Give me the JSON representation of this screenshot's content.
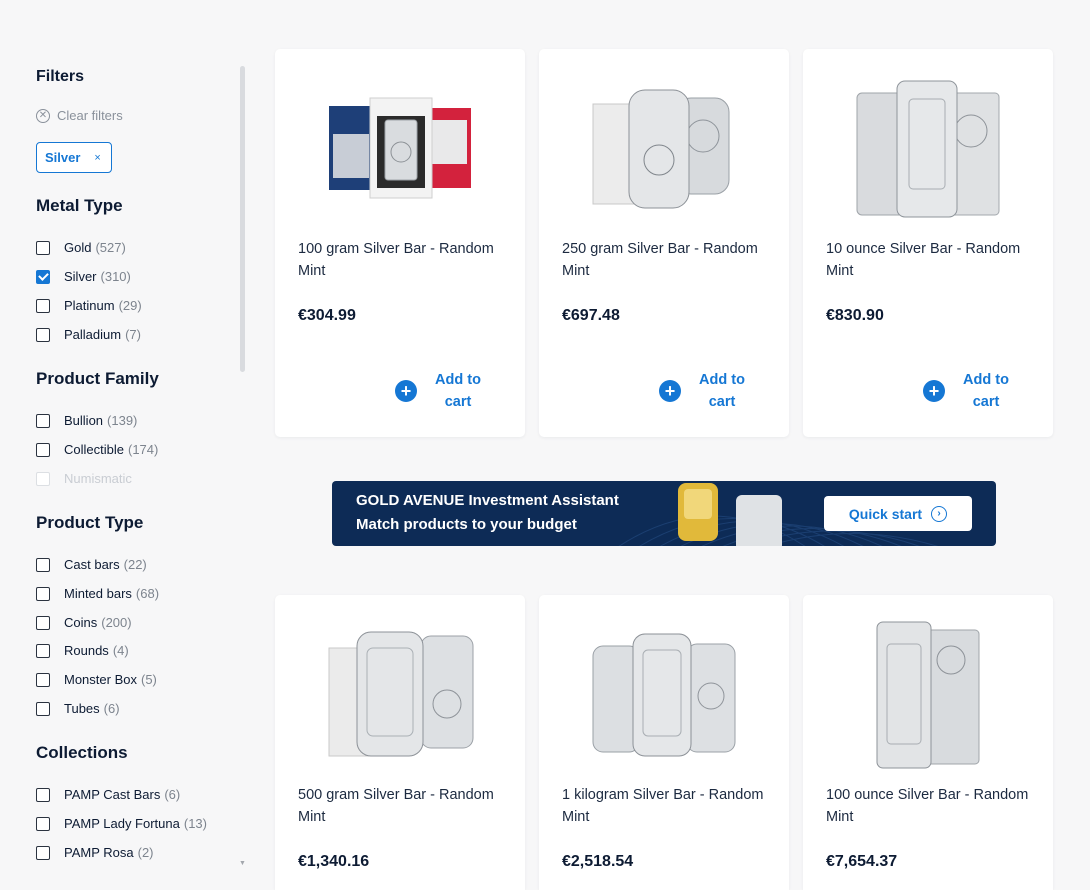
{
  "filters": {
    "title": "Filters",
    "clear_label": "Clear filters",
    "active_chip": {
      "label": "Silver",
      "remove": "×"
    }
  },
  "metal_type": {
    "title": "Metal Type",
    "items": [
      {
        "label": "Gold",
        "count": "(527)",
        "checked": false
      },
      {
        "label": "Silver",
        "count": "(310)",
        "checked": true
      },
      {
        "label": "Platinum",
        "count": "(29)",
        "checked": false
      },
      {
        "label": "Palladium",
        "count": "(7)",
        "checked": false
      }
    ]
  },
  "product_family": {
    "title": "Product Family",
    "items": [
      {
        "label": "Bullion",
        "count": "(139)",
        "checked": false
      },
      {
        "label": "Collectible",
        "count": "(174)",
        "checked": false
      },
      {
        "label": "Numismatic",
        "count": "",
        "checked": false,
        "disabled": true
      }
    ]
  },
  "product_type": {
    "title": "Product Type",
    "items": [
      {
        "label": "Cast bars",
        "count": "(22)",
        "checked": false
      },
      {
        "label": "Minted bars",
        "count": "(68)",
        "checked": false
      },
      {
        "label": "Coins",
        "count": "(200)",
        "checked": false
      },
      {
        "label": "Rounds",
        "count": "(4)",
        "checked": false
      },
      {
        "label": "Monster Box",
        "count": "(5)",
        "checked": false
      },
      {
        "label": "Tubes",
        "count": "(6)",
        "checked": false
      }
    ]
  },
  "collections": {
    "title": "Collections",
    "items": [
      {
        "label": "PAMP Cast Bars",
        "count": "(6)",
        "checked": false
      },
      {
        "label": "PAMP Lady Fortuna",
        "count": "(13)",
        "checked": false
      },
      {
        "label": "PAMP Rosa",
        "count": "(2)",
        "checked": false
      }
    ]
  },
  "products": [
    {
      "name": "100 gram Silver Bar - Random Mint",
      "price": "€304.99",
      "add_label": "Add to cart",
      "image": "silver-bars-100g-image"
    },
    {
      "name": "250 gram Silver Bar - Random Mint",
      "price": "€697.48",
      "add_label": "Add to cart",
      "image": "silver-bars-250g-image"
    },
    {
      "name": "10 ounce Silver Bar - Random Mint",
      "price": "€830.90",
      "add_label": "Add to cart",
      "image": "silver-bars-10oz-image"
    },
    {
      "name": "500 gram Silver Bar - Random Mint",
      "price": "€1,340.16",
      "image": "silver-bars-500g-image"
    },
    {
      "name": "1 kilogram Silver Bar - Random Mint",
      "price": "€2,518.54",
      "image": "silver-bars-1kg-image"
    },
    {
      "name": "100 ounce Silver Bar - Random Mint",
      "price": "€7,654.37",
      "image": "silver-bars-100oz-image"
    }
  ],
  "banner": {
    "line1": "GOLD AVENUE Investment Assistant",
    "line2": "Match products to your budget",
    "button_label": "Quick start",
    "button_icon": "chevron-circle-right-icon"
  },
  "colors": {
    "accent": "#1577d4",
    "heading": "#0d1b33",
    "banner_bg": "#0d2b56"
  }
}
